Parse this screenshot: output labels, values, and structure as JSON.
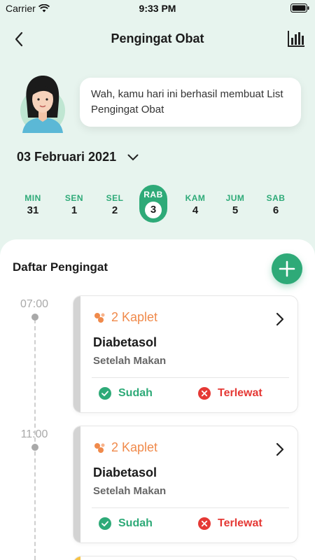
{
  "status_bar": {
    "carrier": "Carrier",
    "time": "9:33 PM"
  },
  "nav": {
    "title": "Pengingat Obat",
    "back_icon": "chevron-left-icon",
    "stats_icon": "bar-chart-icon"
  },
  "greeting": {
    "message": "Wah, kamu hari ini berhasil membuat List Pengingat Obat"
  },
  "date_picker": {
    "date": "03 Februari 2021"
  },
  "week": {
    "days": [
      {
        "name": "MIN",
        "num": "31",
        "active": false
      },
      {
        "name": "SEN",
        "num": "1",
        "active": false
      },
      {
        "name": "SEL",
        "num": "2",
        "active": false
      },
      {
        "name": "RAB",
        "num": "3",
        "active": true
      },
      {
        "name": "KAM",
        "num": "4",
        "active": false
      },
      {
        "name": "JUM",
        "num": "5",
        "active": false
      },
      {
        "name": "SAB",
        "num": "6",
        "active": false
      }
    ]
  },
  "list": {
    "title": "Daftar Pengingat",
    "reminders": [
      {
        "time": "07:00",
        "dose": "2 Kaplet",
        "medicine": "Diabetasol",
        "note": "Setelah Makan",
        "done_label": "Sudah",
        "missed_label": "Terlewat"
      },
      {
        "time": "11:00",
        "dose": "2 Kaplet",
        "medicine": "Diabetasol",
        "note": "Setelah Makan",
        "done_label": "Sudah",
        "missed_label": "Terlewat"
      }
    ]
  },
  "colors": {
    "accent": "#2eaa78",
    "dose": "#f08a4b",
    "missed": "#e53935",
    "background": "#e7f4ee"
  }
}
